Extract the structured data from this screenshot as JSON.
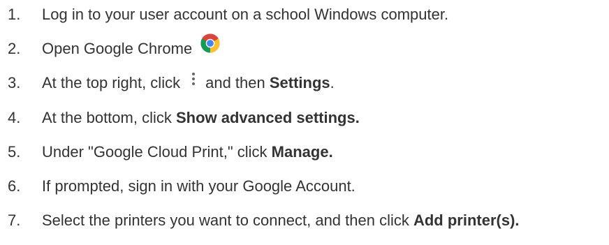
{
  "colors": {
    "text": "#333333",
    "background": "#ffffff"
  },
  "icons": {
    "chrome": "chrome-logo-icon",
    "menu": "three-dot-menu-icon"
  },
  "steps": [
    {
      "num": "1.",
      "text": "Log in to your user account on a school Windows computer."
    },
    {
      "num": "2.",
      "text": "Open Google Chrome"
    },
    {
      "num": "3.",
      "pre": "At the top right, click",
      "mid": "and then",
      "bold": "Settings",
      "post": "."
    },
    {
      "num": "4.",
      "pre": "At the bottom, click",
      "bold": "Show advanced settings."
    },
    {
      "num": "5.",
      "pre": "Under \"Google Cloud Print,\" click",
      "bold": "Manage."
    },
    {
      "num": "6.",
      "text": "If prompted, sign in with your Google Account."
    },
    {
      "num": "7.",
      "pre": "Select the printers you want to connect, and then click",
      "bold": "Add printer(s)."
    }
  ]
}
